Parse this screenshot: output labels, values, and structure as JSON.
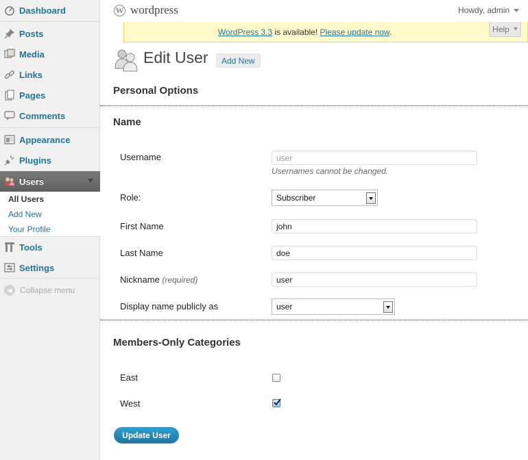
{
  "sidebar": {
    "items": [
      {
        "label": "Dashboard",
        "icon": "dashboard-icon"
      },
      {
        "label": "Posts",
        "icon": "pushpin-icon"
      },
      {
        "label": "Media",
        "icon": "media-icon"
      },
      {
        "label": "Links",
        "icon": "link-icon"
      },
      {
        "label": "Pages",
        "icon": "pages-icon"
      },
      {
        "label": "Comments",
        "icon": "comment-icon"
      },
      {
        "label": "Appearance",
        "icon": "appearance-icon"
      },
      {
        "label": "Plugins",
        "icon": "plug-icon"
      },
      {
        "label": "Users",
        "icon": "users-icon",
        "active": true
      },
      {
        "label": "Tools",
        "icon": "tools-icon"
      },
      {
        "label": "Settings",
        "icon": "settings-icon"
      }
    ],
    "users_submenu": [
      "All Users",
      "Add New",
      "Your Profile"
    ],
    "collapse_label": "Collapse menu"
  },
  "header": {
    "site_name": "wordpress",
    "howdy": "Howdy, admin",
    "help_label": "Help"
  },
  "nag": {
    "version_link": "WordPress 3.3",
    "middle": " is available! ",
    "update_link": "Please update now",
    "end": "."
  },
  "page": {
    "title": "Edit User",
    "add_new": "Add New"
  },
  "sections": {
    "personal_options": "Personal Options",
    "name": "Name",
    "members_only": "Members-Only Categories"
  },
  "fields": {
    "username_label": "Username",
    "username_value": "user",
    "username_desc": "Usernames cannot be changed.",
    "role_label": "Role:",
    "role_value": "Subscriber",
    "first_name_label": "First Name",
    "first_name_value": "john",
    "last_name_label": "Last Name",
    "last_name_value": "doe",
    "nickname_label": "Nickname",
    "nickname_required": "(required)",
    "nickname_value": "user",
    "display_name_label": "Display name publicly as",
    "display_name_value": "user"
  },
  "categories": [
    {
      "label": "East",
      "checked": false
    },
    {
      "label": "West",
      "checked": true
    }
  ],
  "submit_label": "Update User",
  "colors": {
    "link": "#21759b",
    "nag_bg": "#fffbcc",
    "active_menu": "#6d6d6d"
  }
}
